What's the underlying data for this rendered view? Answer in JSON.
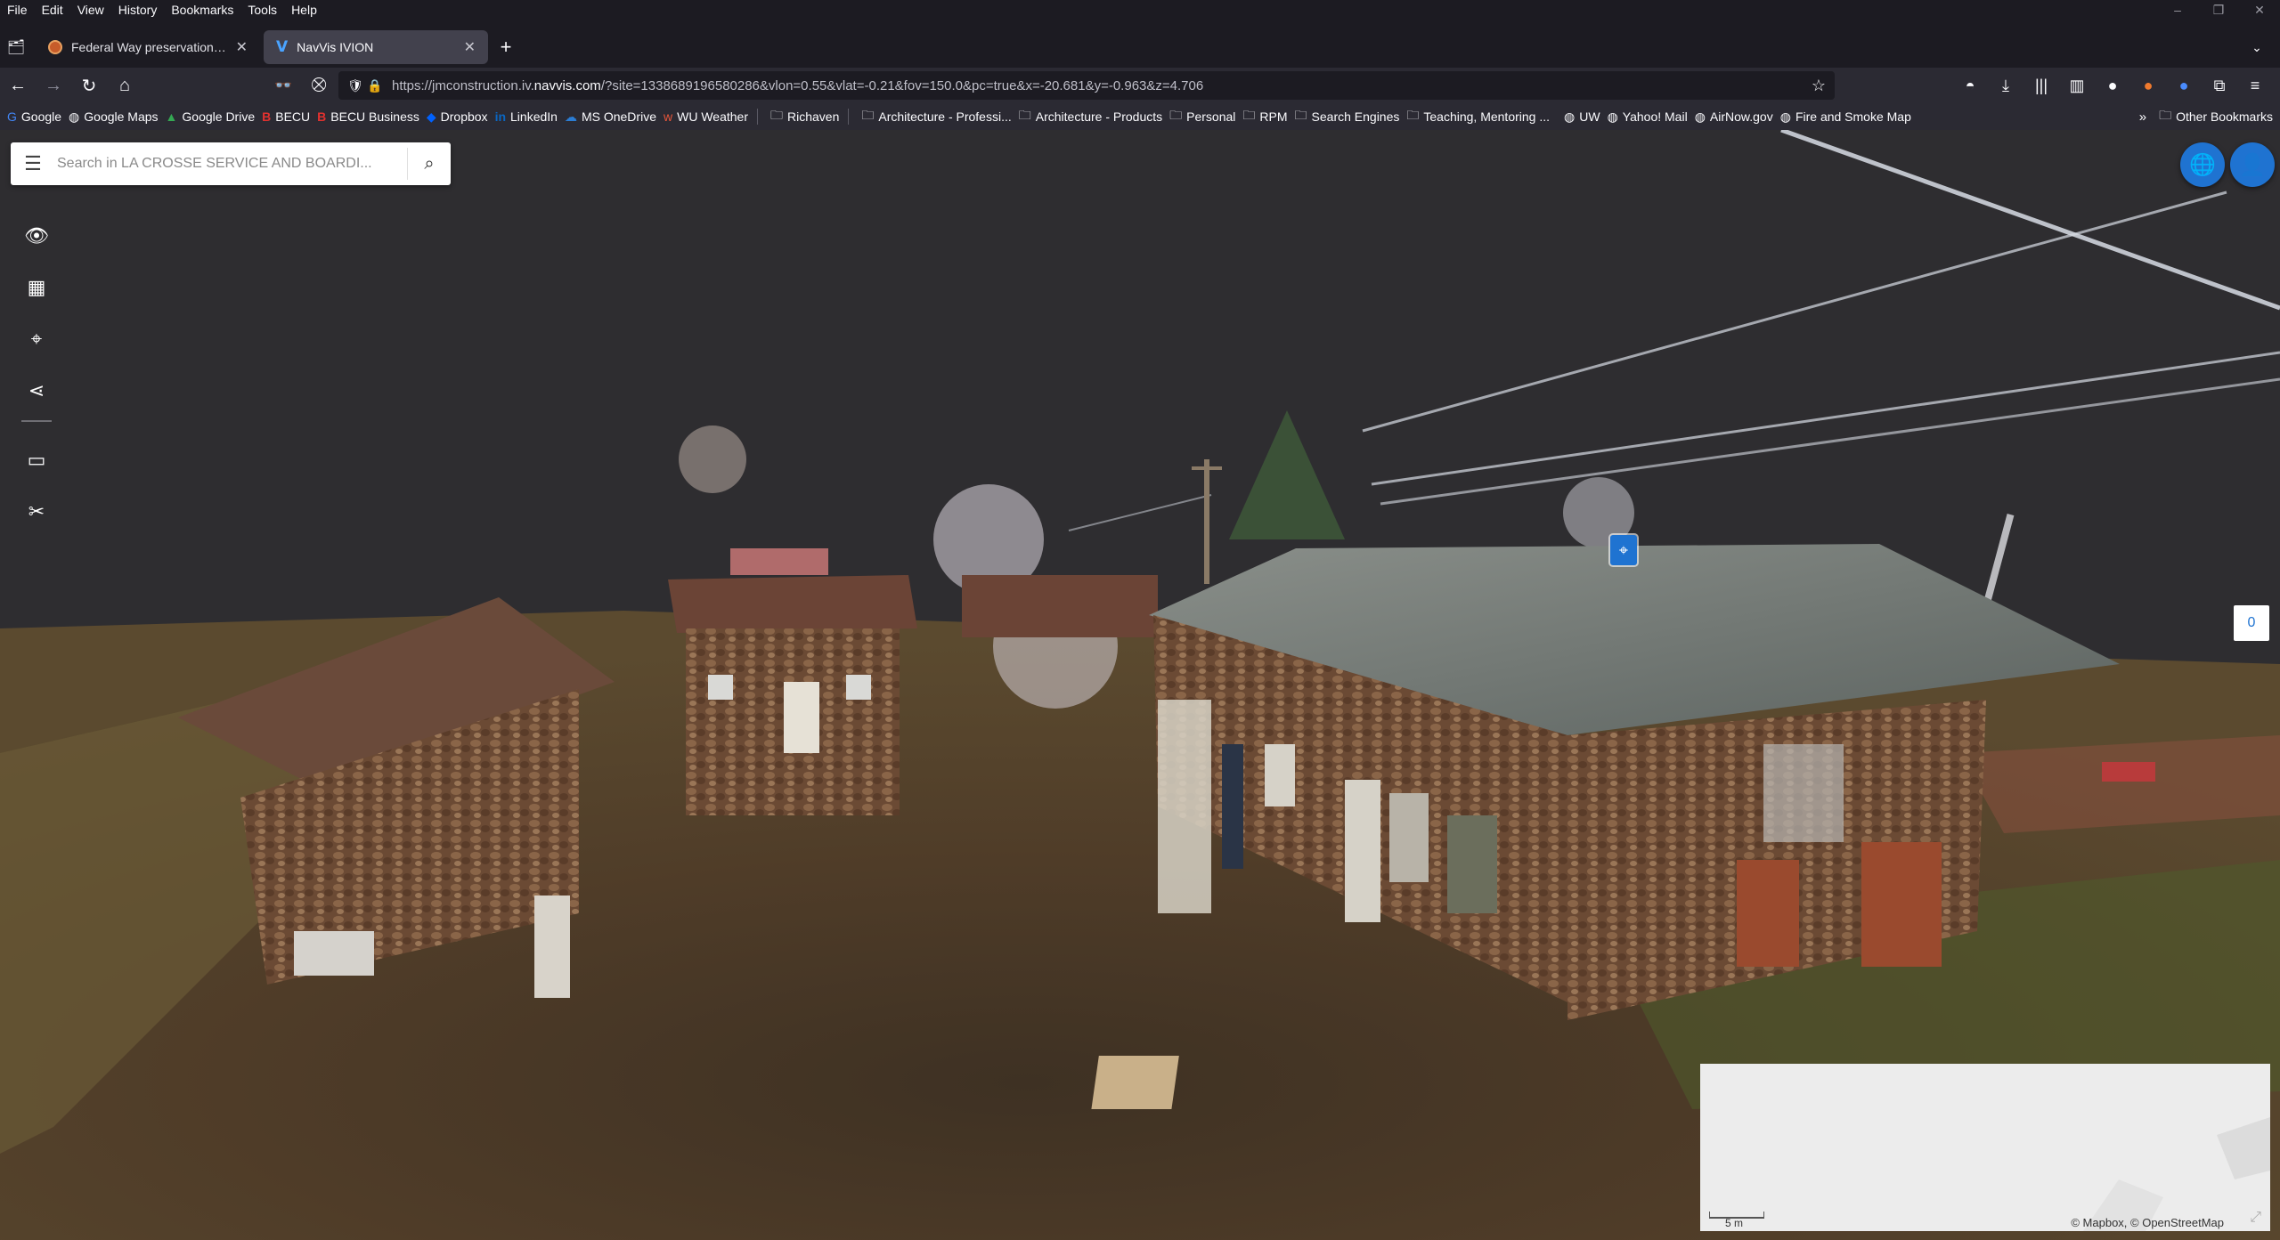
{
  "menubar": {
    "items": [
      "File",
      "Edit",
      "View",
      "History",
      "Bookmarks",
      "Tools",
      "Help"
    ],
    "window_controls": [
      "–",
      "❐",
      "✕"
    ]
  },
  "tabs": [
    {
      "title": "Federal Way preservation legisl",
      "active": false
    },
    {
      "title": "NavVis IVION",
      "active": true
    }
  ],
  "new_tab_label": "+",
  "address_bar": {
    "url_prefix": "https://jmconstruction.iv.",
    "url_domain": "navvis.com",
    "url_suffix": "/?site=1338689196580286&vlon=0.55&vlat=-0.21&fov=150.0&pc=true&x=-20.681&y=-0.963&z=4.706"
  },
  "bookmarks": [
    {
      "label": "Google",
      "icon": "google-icon"
    },
    {
      "label": "Google Maps",
      "icon": "globe-icon"
    },
    {
      "label": "Google Drive",
      "icon": "drive-icon"
    },
    {
      "label": "BECU",
      "icon": "becu-icon"
    },
    {
      "label": "BECU Business",
      "icon": "becu-icon"
    },
    {
      "label": "Dropbox",
      "icon": "dropbox-icon"
    },
    {
      "label": "LinkedIn",
      "icon": "linkedin-icon"
    },
    {
      "label": "MS OneDrive",
      "icon": "onedrive-icon"
    },
    {
      "label": "WU Weather",
      "icon": "weather-icon"
    },
    {
      "label": "Richaven",
      "icon": "folder-icon"
    },
    {
      "label": "Architecture - Professi...",
      "icon": "folder-icon"
    },
    {
      "label": "Architecture - Products",
      "icon": "folder-icon"
    },
    {
      "label": "Personal",
      "icon": "folder-icon"
    },
    {
      "label": "RPM",
      "icon": "folder-icon"
    },
    {
      "label": "Search Engines",
      "icon": "folder-icon"
    },
    {
      "label": "Teaching, Mentoring ...",
      "icon": "folder-icon"
    },
    {
      "label": "UW",
      "icon": "globe-icon"
    },
    {
      "label": "Yahoo! Mail",
      "icon": "globe-icon"
    },
    {
      "label": "AirNow.gov",
      "icon": "globe-icon"
    },
    {
      "label": "Fire and Smoke Map",
      "icon": "globe-icon"
    }
  ],
  "other_bookmarks_label": "Other Bookmarks",
  "viewer": {
    "search_placeholder": "Search in LA CROSSE SERVICE AND BOARDI...",
    "counter_value": "0",
    "minimap": {
      "scale_label": "5 m",
      "attribution": "© Mapbox, © OpenStreetMap"
    }
  },
  "colors": {
    "accent": "#1f73d1",
    "chrome_dark": "#1c1b22",
    "chrome_mid": "#2b2a33"
  }
}
